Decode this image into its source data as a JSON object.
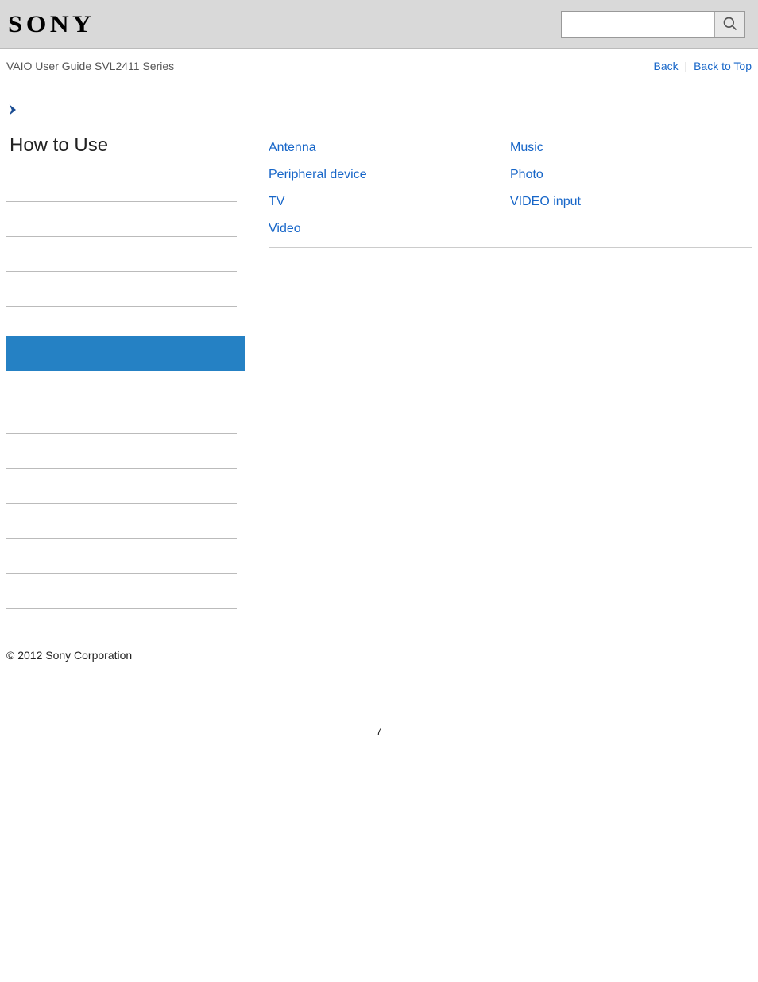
{
  "header": {
    "logo": "SONY"
  },
  "search": {
    "value": "",
    "placeholder": ""
  },
  "subheader": {
    "title": "VAIO User Guide SVL2411 Series",
    "back": "Back",
    "back_to_top": "Back to Top"
  },
  "sidebar": {
    "title": "How to Use"
  },
  "links": {
    "col1": {
      "a": "Antenna",
      "b": "Peripheral device",
      "c": "TV",
      "d": "Video"
    },
    "col2": {
      "a": "Music",
      "b": "Photo",
      "c": "VIDEO input"
    }
  },
  "footer": {
    "copyright": "© 2012 Sony Corporation"
  },
  "page_number": "7"
}
